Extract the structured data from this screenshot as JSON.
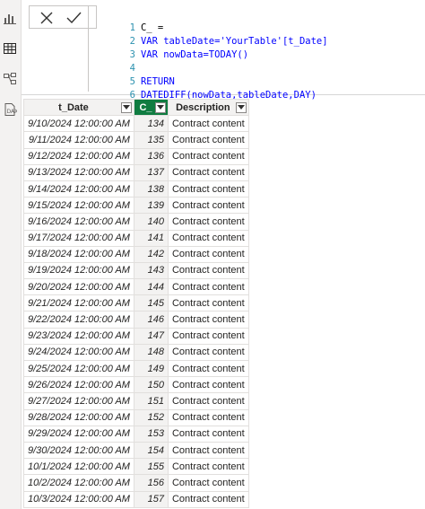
{
  "formula": {
    "lines": [
      {
        "num": "1",
        "text": "C_ ="
      },
      {
        "num": "2",
        "text": "VAR tableDate='YourTable'[t_Date]"
      },
      {
        "num": "3",
        "text": "VAR nowData=TODAY()"
      },
      {
        "num": "4",
        "text": ""
      },
      {
        "num": "5",
        "text": "RETURN"
      },
      {
        "num": "6",
        "text": "DATEDIFF(nowData,tableDate,DAY)"
      }
    ]
  },
  "table": {
    "columns": [
      "t_Date",
      "C_",
      "Description"
    ],
    "rows": [
      [
        "9/10/2024 12:00:00 AM",
        "134",
        "Contract content"
      ],
      [
        "9/11/2024 12:00:00 AM",
        "135",
        "Contract content"
      ],
      [
        "9/12/2024 12:00:00 AM",
        "136",
        "Contract content"
      ],
      [
        "9/13/2024 12:00:00 AM",
        "137",
        "Contract content"
      ],
      [
        "9/14/2024 12:00:00 AM",
        "138",
        "Contract content"
      ],
      [
        "9/15/2024 12:00:00 AM",
        "139",
        "Contract content"
      ],
      [
        "9/16/2024 12:00:00 AM",
        "140",
        "Contract content"
      ],
      [
        "9/17/2024 12:00:00 AM",
        "141",
        "Contract content"
      ],
      [
        "9/18/2024 12:00:00 AM",
        "142",
        "Contract content"
      ],
      [
        "9/19/2024 12:00:00 AM",
        "143",
        "Contract content"
      ],
      [
        "9/20/2024 12:00:00 AM",
        "144",
        "Contract content"
      ],
      [
        "9/21/2024 12:00:00 AM",
        "145",
        "Contract content"
      ],
      [
        "9/22/2024 12:00:00 AM",
        "146",
        "Contract content"
      ],
      [
        "9/23/2024 12:00:00 AM",
        "147",
        "Contract content"
      ],
      [
        "9/24/2024 12:00:00 AM",
        "148",
        "Contract content"
      ],
      [
        "9/25/2024 12:00:00 AM",
        "149",
        "Contract content"
      ],
      [
        "9/26/2024 12:00:00 AM",
        "150",
        "Contract content"
      ],
      [
        "9/27/2024 12:00:00 AM",
        "151",
        "Contract content"
      ],
      [
        "9/28/2024 12:00:00 AM",
        "152",
        "Contract content"
      ],
      [
        "9/29/2024 12:00:00 AM",
        "153",
        "Contract content"
      ],
      [
        "9/30/2024 12:00:00 AM",
        "154",
        "Contract content"
      ],
      [
        "10/1/2024 12:00:00 AM",
        "155",
        "Contract content"
      ],
      [
        "10/2/2024 12:00:00 AM",
        "156",
        "Contract content"
      ],
      [
        "10/3/2024 12:00:00 AM",
        "157",
        "Contract content"
      ]
    ]
  },
  "icons": {
    "rail": [
      "report-view-icon",
      "table-view-icon",
      "model-view-icon",
      "dax-query-view-icon"
    ],
    "formula_bar": [
      "cancel-icon",
      "commit-check-icon"
    ]
  },
  "colors": {
    "selected_column_header": "#107c41",
    "keyword": "#0000ff",
    "string": "#a31515",
    "line_number": "#2b91af"
  }
}
